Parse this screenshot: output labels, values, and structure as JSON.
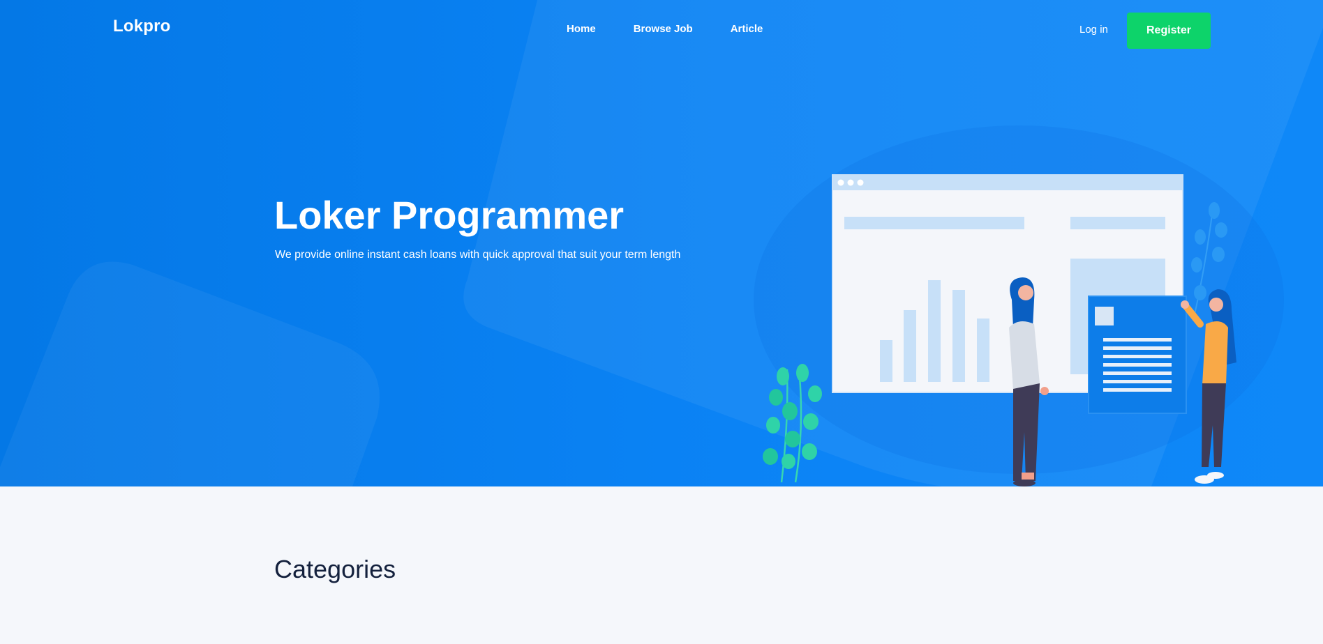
{
  "nav": {
    "logo": "Lokpro",
    "links": [
      "Home",
      "Browse Job",
      "Article"
    ],
    "login": "Log in",
    "register": "Register"
  },
  "hero": {
    "title": "Loker Programmer",
    "subtitle": "We provide online instant cash loans with quick approval that suit your term length"
  },
  "sections": {
    "categories_title": "Categories"
  },
  "colors": {
    "hero_blue": "#0b83f5",
    "register_green": "#0dd36a",
    "page_background": "#f5f7fb",
    "heading_dark": "#14213d"
  }
}
